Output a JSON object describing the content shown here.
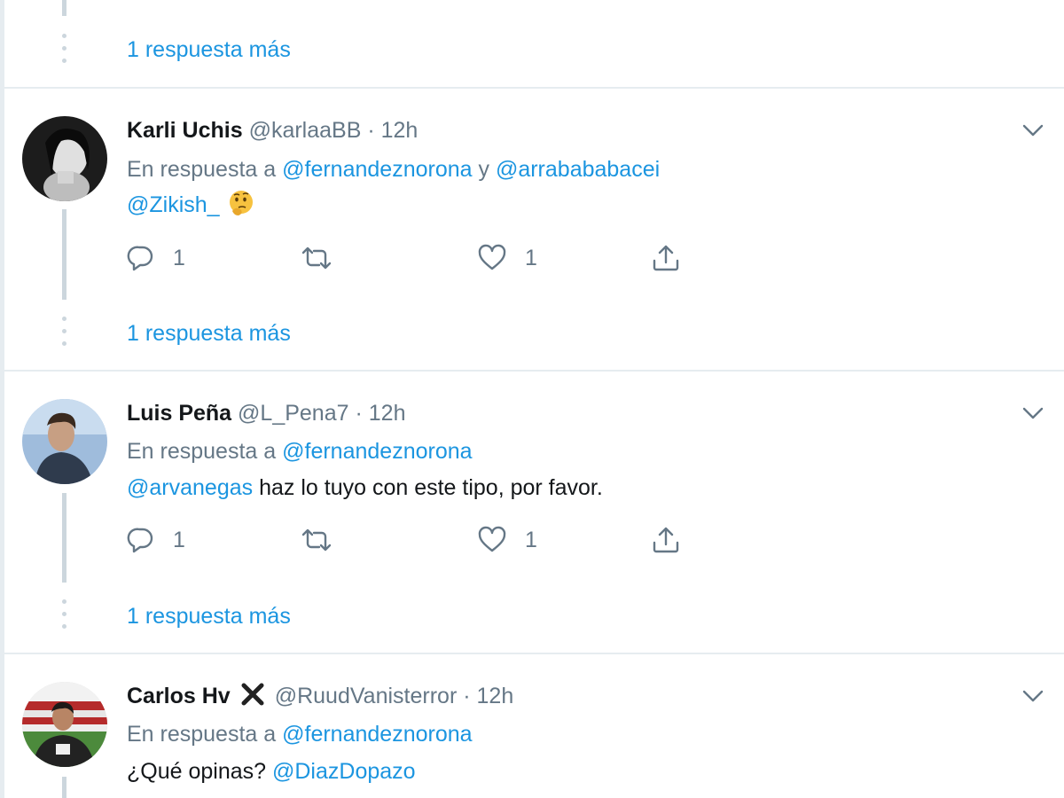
{
  "more_replies_label": "1 respuesta más",
  "tweets": [
    {
      "name": "Karli Uchis",
      "handle": "@karlaaBB",
      "separator": "·",
      "time": "12h",
      "reply_prefix": "En respuesta a",
      "reply_mentions": [
        "@fernandeznorona",
        "@arrabababacei"
      ],
      "reply_joiner": "y",
      "text_mention": "@Zikish_",
      "emoji": "thinking-face",
      "reply_count": "1",
      "like_count": "1"
    },
    {
      "name": "Luis Peña",
      "handle": "@L_Pena7",
      "separator": "·",
      "time": "12h",
      "reply_prefix": "En respuesta a",
      "reply_mentions": [
        "@fernandeznorona"
      ],
      "text_mention": "@arvanegas",
      "text": "haz lo tuyo con este tipo, por favor.",
      "reply_count": "1",
      "like_count": "1"
    },
    {
      "name": "Carlos Hv",
      "name_badge": "cross-mark-icon",
      "handle": "@RuudVanisterror",
      "separator": "·",
      "time": "12h",
      "reply_prefix": "En respuesta a",
      "reply_mentions": [
        "@fernandeznorona"
      ],
      "text_prefix": "¿Qué opinas?",
      "text_mention": "@DiazDopazo"
    }
  ],
  "colors": {
    "link": "#1b95e0",
    "secondary": "#657786",
    "primary_text": "#14171a",
    "thread_line": "#ccd6dd",
    "separator": "#e6ecf0"
  },
  "icons": [
    "reply-icon",
    "retweet-icon",
    "like-icon",
    "share-icon",
    "chevron-down-icon"
  ]
}
